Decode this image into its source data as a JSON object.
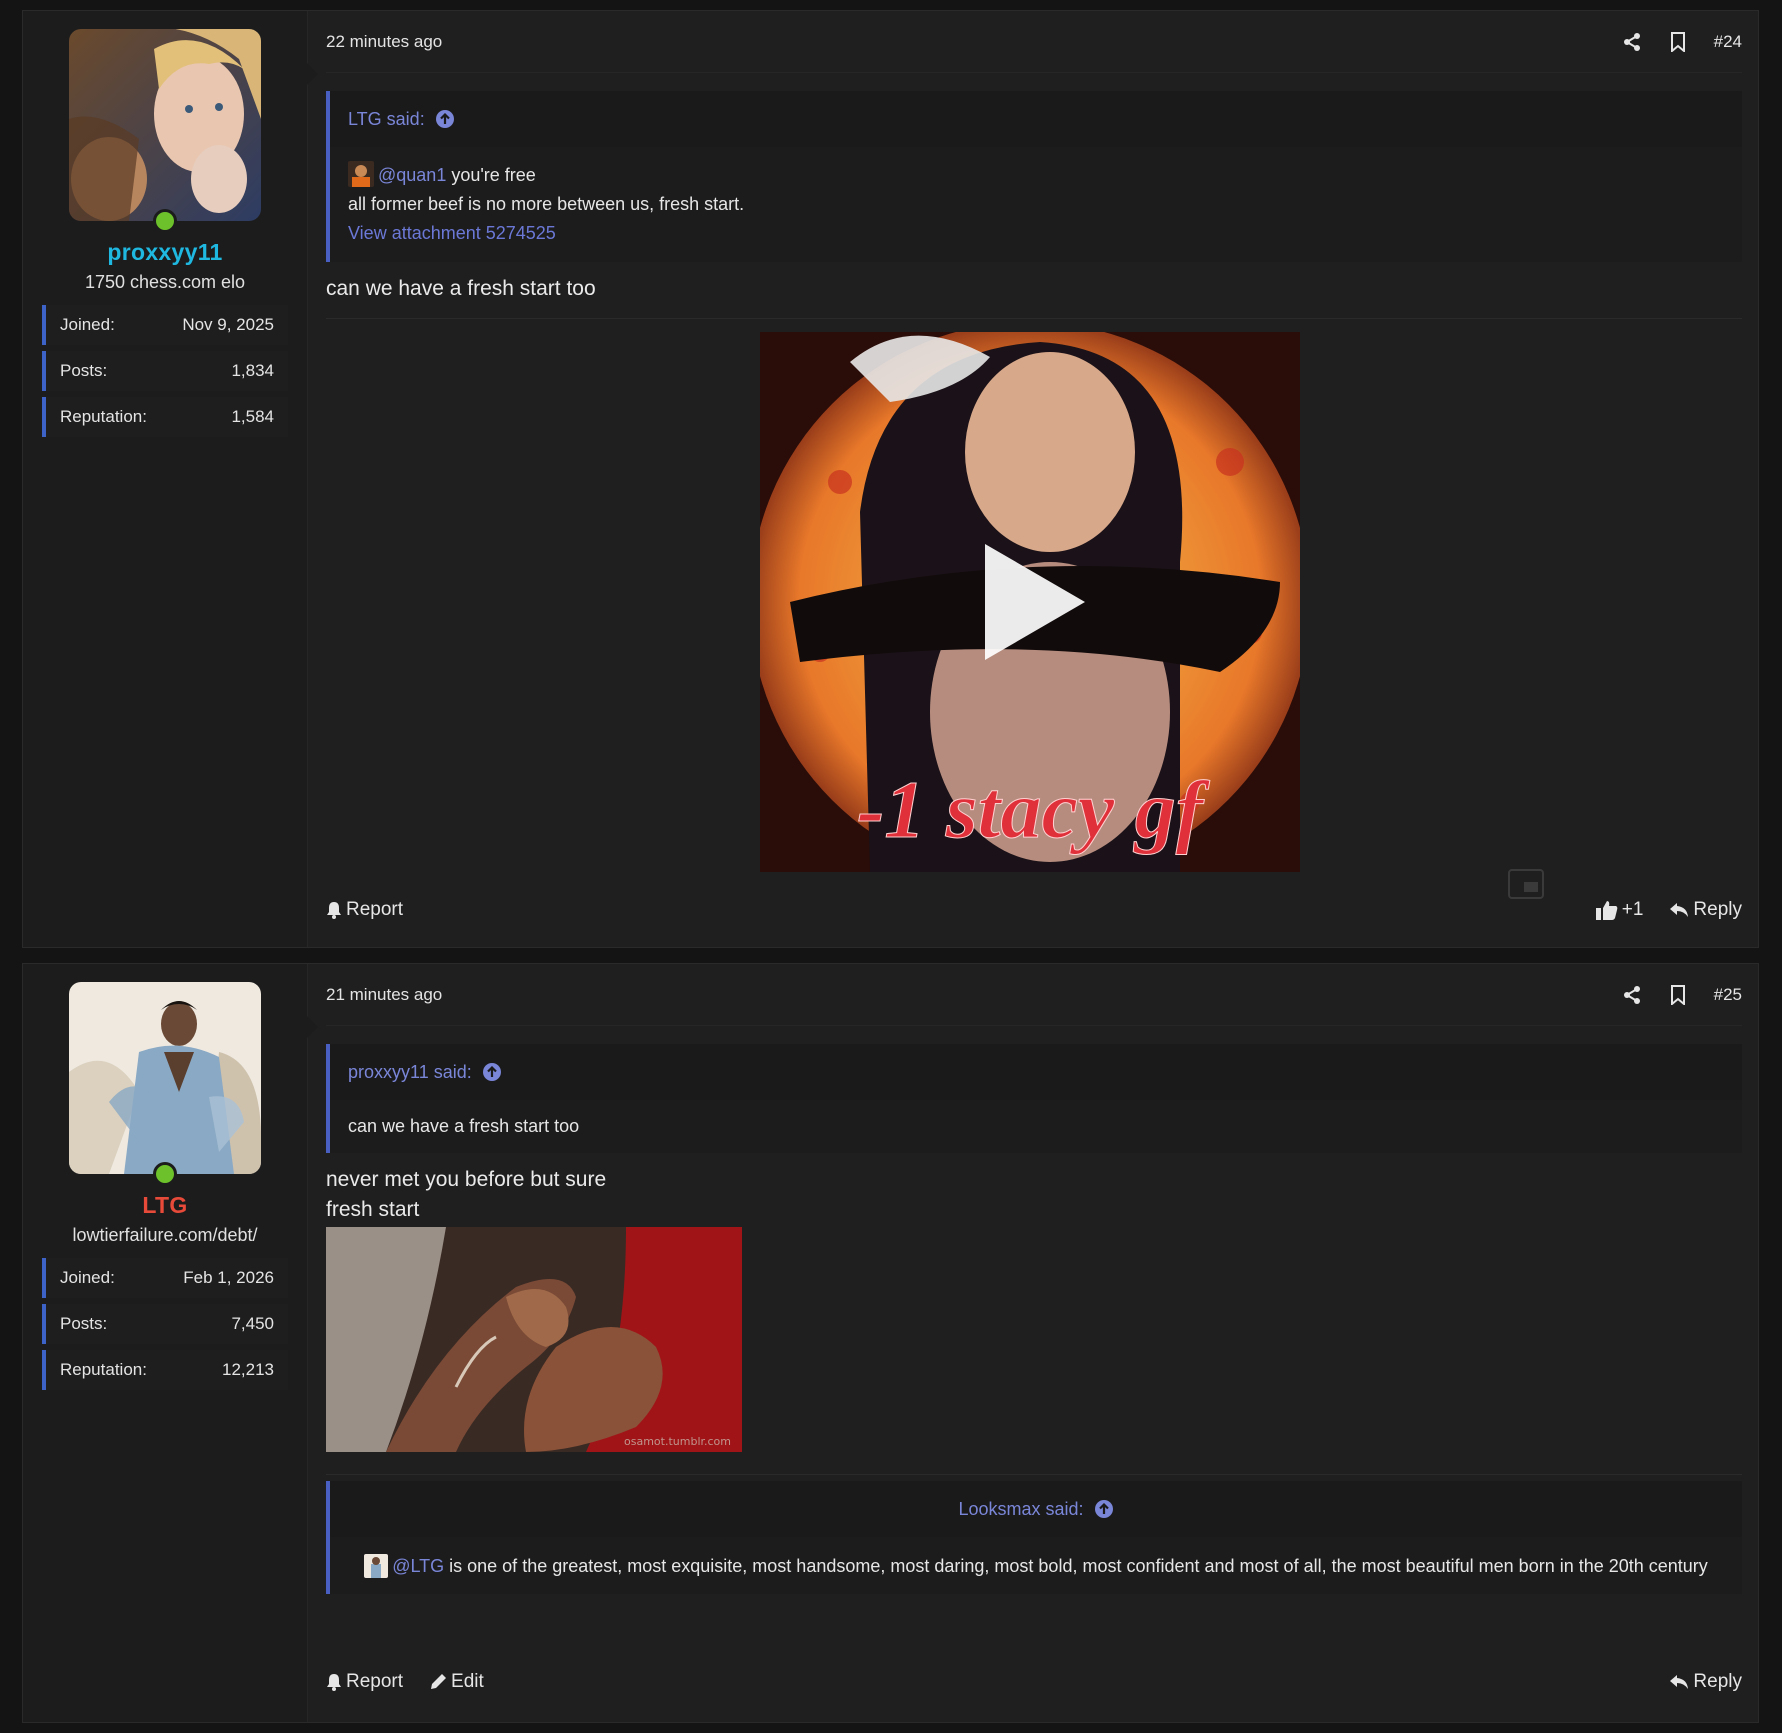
{
  "posts": [
    {
      "user": {
        "name": "proxxyy11",
        "title": "1750 chess.com elo",
        "stats": [
          {
            "label": "Joined:",
            "value": "Nov 9, 2025"
          },
          {
            "label": "Posts:",
            "value": "1,834"
          },
          {
            "label": "Reputation:",
            "value": "1,584"
          }
        ]
      },
      "time": "22 minutes ago",
      "number": "#24",
      "quote": {
        "author": "LTG said:",
        "mention": "@quan1",
        "line1_rest": " you're free",
        "line2": "all former beef is no more between us, fresh start.",
        "attachment": "View attachment 5274525"
      },
      "text": "can we have a fresh start too",
      "video_caption": "-1 stacy gf",
      "actions": {
        "report": "Report",
        "like_count": "+1",
        "reply": "Reply"
      }
    },
    {
      "user": {
        "name": "LTG",
        "title": "lowtierfailure.com/debt/",
        "stats": [
          {
            "label": "Joined:",
            "value": "Feb 1, 2026"
          },
          {
            "label": "Posts:",
            "value": "7,450"
          },
          {
            "label": "Reputation:",
            "value": "12,213"
          }
        ]
      },
      "time": "21 minutes ago",
      "number": "#25",
      "quote": {
        "author": "proxxyy11 said:",
        "text": "can we have a fresh start too"
      },
      "text_line1": "never met you before but sure",
      "text_line2": "fresh start",
      "gif_watermark": "osamot.tumblr.com",
      "signature_quote": {
        "author": "Looksmax said:",
        "mention": "@LTG",
        "text": " is one of the greatest, most exquisite, most handsome, most daring, most bold, most confident and most of all, the most beautiful men born in the 20th century"
      },
      "actions": {
        "report": "Report",
        "edit": "Edit",
        "reply": "Reply"
      }
    }
  ],
  "colors": {
    "username_cyan": "#1fb8e0",
    "username_red": "#e84a3a",
    "online": "#6dc22b",
    "quote_accent": "#4a5fc2",
    "link": "#7a86d8"
  }
}
